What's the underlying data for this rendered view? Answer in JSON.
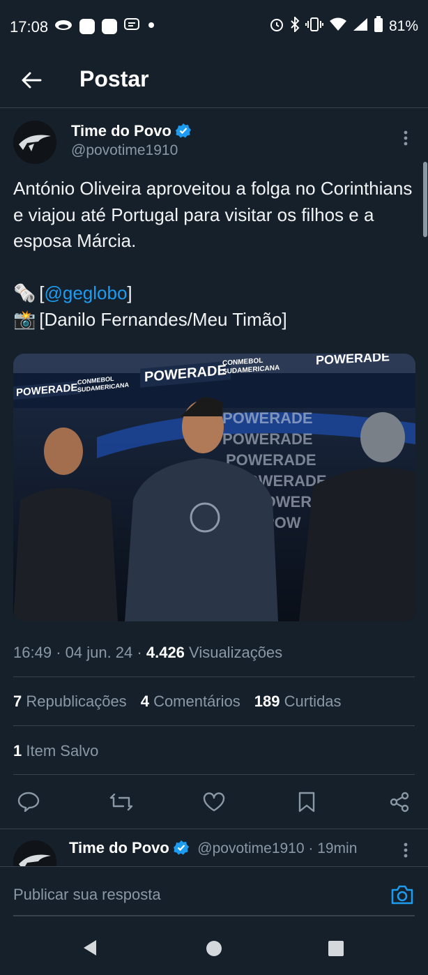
{
  "status_bar": {
    "time": "17:08",
    "left_icons": [
      "cast-icon",
      "app-square-icon",
      "app-square-icon",
      "message-icon",
      "dot-icon"
    ],
    "right_icons": [
      "alarm-icon",
      "bluetooth-icon",
      "vibrate-icon",
      "wifi-icon",
      "signal-icon",
      "battery-icon"
    ],
    "battery": "81%"
  },
  "app_bar": {
    "title": "Postar"
  },
  "tweet": {
    "author_name": "Time do Povo",
    "handle": "@povotime1910",
    "text_line1": "António Oliveira aproveitou a folga no Corinthians e viajou até Portugal para visitar os filhos e a esposa Márcia.",
    "source_emoji": "🗞️",
    "source_bracket_open": "[",
    "source_link": "@geglobo",
    "source_bracket_close": "]",
    "photo_emoji": "📸",
    "photo_credit": "[Danilo Fernandes/Meu Timão]",
    "image_signs": {
      "sign1": "POWERADE",
      "sign2": "CONMEBOL SUDAMERICANA",
      "sign3": "POWERADE",
      "sign4": "CONMEBOL SUDAMERICANA",
      "sign5": "POWERADE",
      "sign6": "CONMEBOL SUDAMERICANA"
    },
    "time": "16:49",
    "date": "04 jun. 24",
    "separator": "·",
    "views_count": "4.426",
    "views_label": "Visualizações",
    "reposts_count": "7",
    "reposts_label": "Republicações",
    "comments_count": "4",
    "comments_label": "Comentários",
    "likes_count": "189",
    "likes_label": "Curtidas",
    "saved_count": "1",
    "saved_label": "Item Salvo"
  },
  "reply_preview": {
    "author_name": "Time do Povo",
    "handle_time": "@povotime1910 · 19min"
  },
  "compose": {
    "placeholder": "Publicar sua resposta"
  },
  "colors": {
    "background": "#15202b",
    "accent": "#1d9bf0",
    "muted": "#8b98a5",
    "divider": "#38444d"
  }
}
